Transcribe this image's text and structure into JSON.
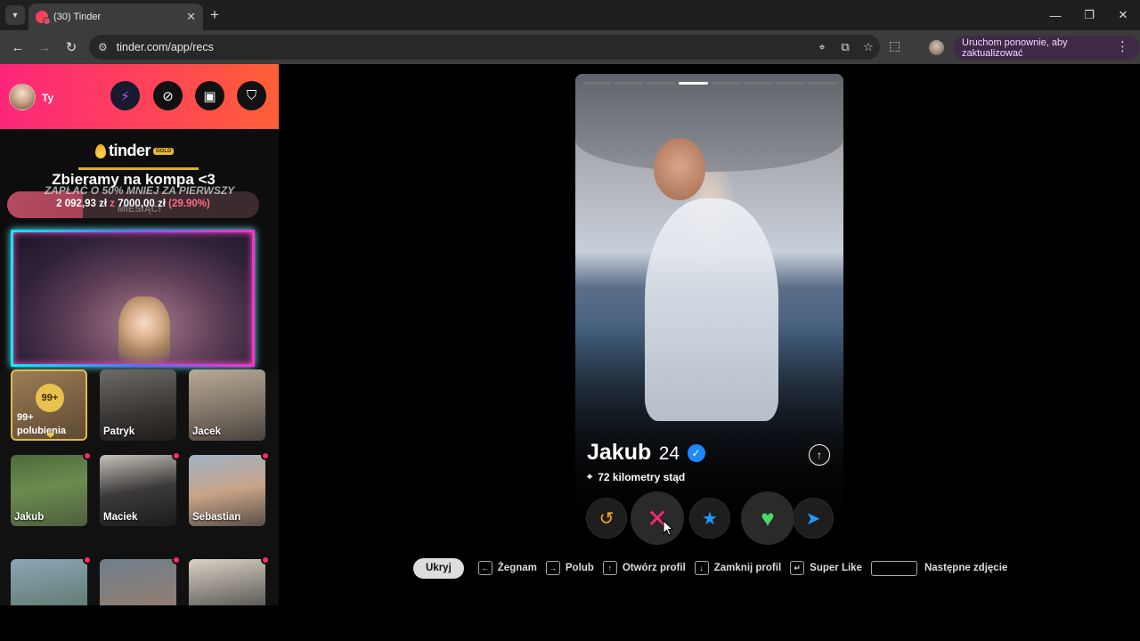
{
  "browser": {
    "tab_title": "(30) Tinder",
    "new_tab_symbol": "+",
    "close_tab_symbol": "✕",
    "url": "tinder.com/app/recs",
    "update_button": "Uruchom ponownie, aby zaktualizować",
    "window": {
      "minimize": "—",
      "restore": "❐",
      "close": "✕"
    },
    "nav": {
      "back": "←",
      "forward": "→",
      "reload": "↻"
    }
  },
  "sidebar": {
    "user_name": "Ty",
    "header_buttons": [
      "boost-icon",
      "explore-icon",
      "briefcase-icon",
      "shield-icon"
    ],
    "overlay": {
      "logo_word": "tinder",
      "logo_badge": "GOLD",
      "goal_title": "Zbieramy na kompa <3",
      "promo_line_1": "ZAPŁAĆ O 50% MNIEJ ZA PIERWSZY",
      "promo_line_2": "MIESIĄC!",
      "raised": "2 092,93 zł",
      "separator": "z",
      "target": "7000,00 zł",
      "percent_text": "(29.90%)",
      "progress_fraction": 0.299
    },
    "likes_tile": {
      "count": "99+",
      "label_line_1": "99+",
      "label_line_2": "polubienia"
    },
    "matches": [
      {
        "name": "Patryk"
      },
      {
        "name": "Jacek"
      },
      {
        "name": "Jakub"
      },
      {
        "name": "Maciek"
      },
      {
        "name": "Sebastian"
      },
      {
        "name": ""
      },
      {
        "name": ""
      },
      {
        "name": ""
      }
    ]
  },
  "profile": {
    "name": "Jakub",
    "age": "24",
    "distance": "72 kilometry stąd",
    "photo_count": 8,
    "active_photo_index": 3,
    "verified": true
  },
  "shortcuts": {
    "hide_button": "Ukryj",
    "items": [
      {
        "key": "←",
        "label": "Żegnam"
      },
      {
        "key": "→",
        "label": "Polub"
      },
      {
        "key": "↑",
        "label": "Otwórz profil"
      },
      {
        "key": "↓",
        "label": "Zamknij profil"
      },
      {
        "key": "↵",
        "label": "Super Like"
      },
      {
        "key": "",
        "label": "Następne zdjęcie"
      }
    ]
  },
  "colors": {
    "brand_gradient_start": "#fd267a",
    "brand_gradient_end": "#ff6036",
    "gold": "#e8c14f",
    "like_green": "#4cd964",
    "superlike_blue": "#1e9bff",
    "rewind_orange": "#f5a623"
  }
}
